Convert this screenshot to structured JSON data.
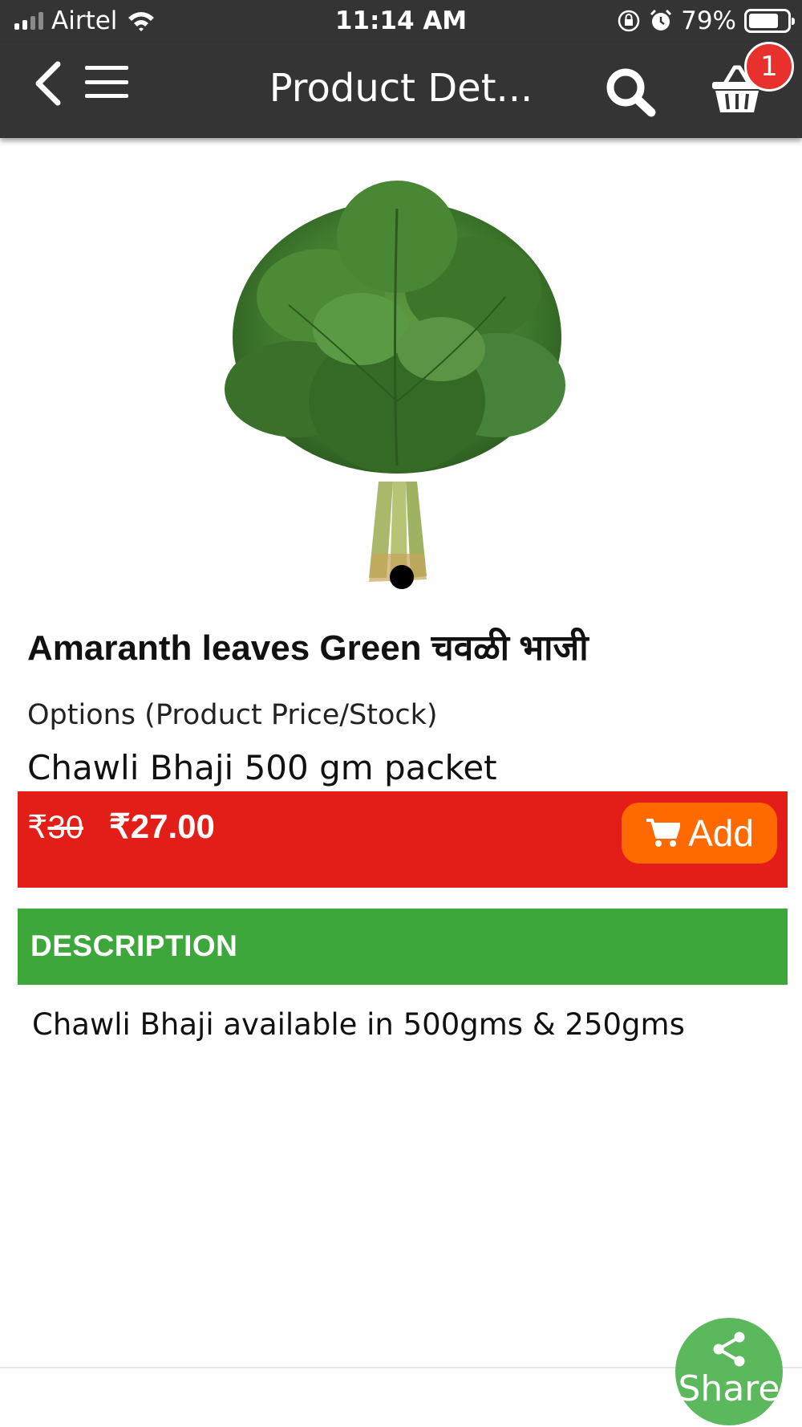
{
  "status_bar": {
    "carrier": "Airtel",
    "time": "11:14 AM",
    "battery": "79%",
    "battery_level": 0.79,
    "icons": [
      "signal-icon",
      "wifi-icon",
      "orientation-lock-icon",
      "alarm-icon",
      "battery-icon"
    ]
  },
  "app_bar": {
    "title": "Product Det...",
    "cart_count": "1",
    "background": "#343434",
    "icons": [
      "back-icon",
      "menu-icon",
      "search-icon",
      "cart-icon"
    ]
  },
  "product": {
    "image_alt": "Amaranth leaves bunch",
    "name": "Amaranth leaves Green चवळी भाजी",
    "options_label": "Options (Product Price/Stock)",
    "variant": "Chawli Bhaji 500 gm packet",
    "currency": "₹",
    "old_price": "30",
    "new_price": "₹27.00",
    "add_label": "Add"
  },
  "description": {
    "title": "DESCRIPTION",
    "text": "Chawli Bhaji available in 500gms & 250gms"
  },
  "share": {
    "label": "Share"
  },
  "colors": {
    "price_bar": "#e31e18",
    "add_button": "#ff6a00",
    "description_header": "#3ea73b",
    "share_fab": "#5cb85c",
    "cart_badge": "#e8302c"
  }
}
